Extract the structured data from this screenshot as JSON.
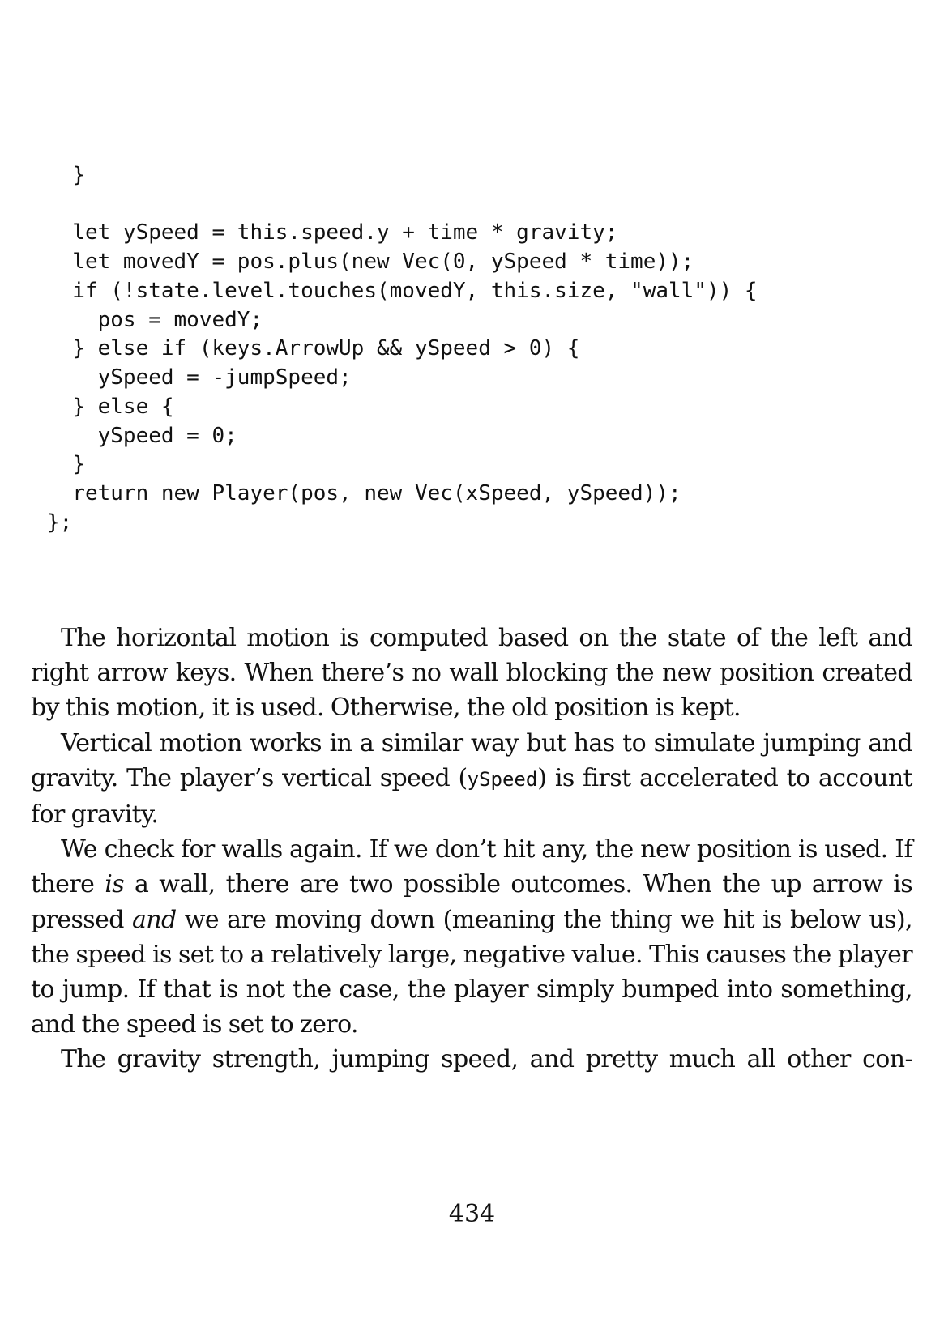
{
  "code": {
    "lines": [
      "  }",
      "",
      "  let ySpeed = this.speed.y + time * gravity;",
      "  let movedY = pos.plus(new Vec(0, ySpeed * time));",
      "  if (!state.level.touches(movedY, this.size, \"wall\")) {",
      "    pos = movedY;",
      "  } else if (keys.ArrowUp && ySpeed > 0) {",
      "    ySpeed = -jumpSpeed;",
      "  } else {",
      "    ySpeed = 0;",
      "  }",
      "  return new Player(pos, new Vec(xSpeed, ySpeed));",
      "};"
    ]
  },
  "prose": {
    "p1": "The horizontal motion is computed based on the state of the left and right arrow keys. When there’s no wall blocking the new position created by this motion, it is used. Otherwise, the old position is kept.",
    "p2_before": "Vertical motion works in a similar way but has to simulate jumping and gravity. The player’s vertical speed (",
    "p2_code": "ySpeed",
    "p2_after": ") is first accelerated to account for gravity.",
    "p3_a": "We check for walls again. If we don’t hit any, the new position is used. If there ",
    "p3_em1": "is",
    "p3_b": " a wall, there are two possible outcomes. When the up arrow is pressed ",
    "p3_em2": "and",
    "p3_c": " we are moving down (meaning the thing we hit is below us), the speed is set to a relatively large, negative value. This causes the player to jump. If that is not the case, the player simply bumped into something, and the speed is set to zero.",
    "p4": "The gravity strength, jumping speed, and pretty much all other con-"
  },
  "page_number": "434"
}
